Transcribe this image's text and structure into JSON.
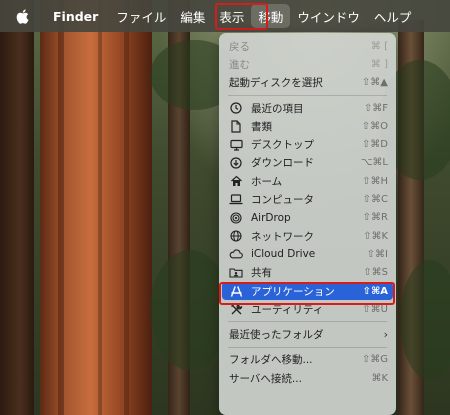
{
  "menubar": {
    "apple": "apple-logo",
    "app": "Finder",
    "items": [
      "ファイル",
      "編集",
      "表示",
      "移動",
      "ウインドウ",
      "ヘルプ"
    ],
    "active_index": 3
  },
  "go_menu": {
    "back": {
      "label": "戻る",
      "shortcut": "⌘ ["
    },
    "forward": {
      "label": "進む",
      "shortcut": "⌘ ]"
    },
    "startup": {
      "label": "起動ディスクを選択",
      "shortcut": "⇧⌘▲"
    },
    "places": [
      {
        "label": "最近の項目",
        "shortcut": "⇧⌘F",
        "icon": "clock-icon"
      },
      {
        "label": "書類",
        "shortcut": "⇧⌘O",
        "icon": "document-icon"
      },
      {
        "label": "デスクトップ",
        "shortcut": "⇧⌘D",
        "icon": "desktop-icon"
      },
      {
        "label": "ダウンロード",
        "shortcut": "⌥⌘L",
        "icon": "download-icon"
      },
      {
        "label": "ホーム",
        "shortcut": "⇧⌘H",
        "icon": "home-icon"
      },
      {
        "label": "コンピュータ",
        "shortcut": "⇧⌘C",
        "icon": "laptop-icon"
      },
      {
        "label": "AirDrop",
        "shortcut": "⇧⌘R",
        "icon": "airdrop-icon"
      },
      {
        "label": "ネットワーク",
        "shortcut": "⇧⌘K",
        "icon": "globe-icon"
      },
      {
        "label": "iCloud Drive",
        "shortcut": "⇧⌘I",
        "icon": "cloud-icon"
      },
      {
        "label": "共有",
        "shortcut": "⇧⌘S",
        "icon": "shared-folder-icon"
      },
      {
        "label": "アプリケーション",
        "shortcut": "⇧⌘A",
        "icon": "applications-icon"
      },
      {
        "label": "ユーティリティ",
        "shortcut": "⇧⌘U",
        "icon": "utilities-icon"
      }
    ],
    "selected_index": 10,
    "recent_folders": {
      "label": "最近使ったフォルダ",
      "icon": "chevron-right-icon"
    },
    "goto_folder": {
      "label": "フォルダへ移動...",
      "shortcut": "⇧⌘G"
    },
    "connect_server": {
      "label": "サーバへ接続...",
      "shortcut": "⌘K"
    }
  },
  "colors": {
    "highlight_box": "#d81c1c",
    "selection": "#2a63d8"
  }
}
